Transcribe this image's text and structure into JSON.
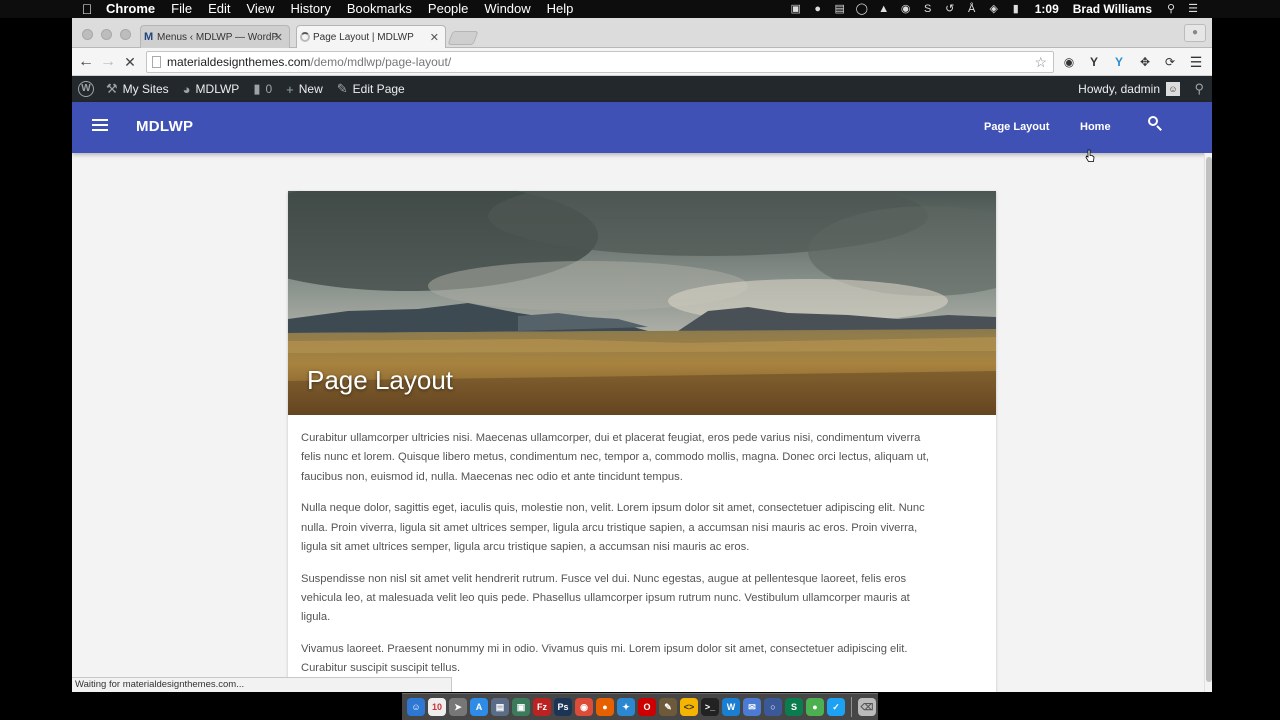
{
  "menubar": {
    "app": "Chrome",
    "items": [
      "File",
      "Edit",
      "View",
      "History",
      "Bookmarks",
      "People",
      "Window",
      "Help"
    ],
    "time": "1:09",
    "user": "Brad Williams"
  },
  "tabs": [
    {
      "title": "Menus ‹ MDLWP — WordP",
      "favicon": "M"
    },
    {
      "title": "Page Layout | MDLWP"
    }
  ],
  "url": {
    "host": "materialdesignthemes.com",
    "path": "/demo/mdlwp/page-layout/"
  },
  "adminbar": {
    "my_sites": "My Sites",
    "site": "MDLWP",
    "comments": "0",
    "new": "New",
    "edit": "Edit Page",
    "howdy": "Howdy, dadmin"
  },
  "appbar": {
    "brand": "MDLWP",
    "nav": [
      "Page Layout",
      "Home"
    ],
    "color": "#3f51b5"
  },
  "page": {
    "title": "Page Layout",
    "paragraphs": [
      "Curabitur ullamcorper ultricies nisi. Maecenas ullamcorper, dui et placerat feugiat, eros pede varius nisi, condimentum viverra felis nunc et lorem. Quisque libero metus, condimentum nec, tempor a, commodo mollis, magna. Donec orci lectus, aliquam ut, faucibus non, euismod id, nulla. Maecenas nec odio et ante tincidunt tempus.",
      "Nulla neque dolor, sagittis eget, iaculis quis, molestie non, velit. Lorem ipsum dolor sit amet, consectetuer adipiscing elit. Nunc nulla. Proin viverra, ligula sit amet ultrices semper, ligula arcu tristique sapien, a accumsan nisi mauris ac eros. Proin viverra, ligula sit amet ultrices semper, ligula arcu tristique sapien, a accumsan nisi mauris ac eros.",
      "Suspendisse non nisl sit amet velit hendrerit rutrum. Fusce vel dui. Nunc egestas, augue at pellentesque laoreet, felis eros vehicula leo, at malesuada velit leo quis pede. Phasellus ullamcorper ipsum rutrum nunc. Vestibulum ullamcorper mauris at ligula.",
      "Vivamus laoreet. Praesent nonummy mi in odio. Vivamus quis mi. Lorem ipsum dolor sit amet, consectetuer adipiscing elit. Curabitur suscipit suscipit tellus."
    ]
  },
  "status": "Waiting for materialdesignthemes.com..."
}
